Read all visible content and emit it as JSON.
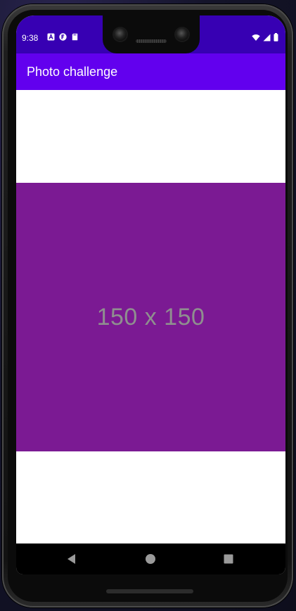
{
  "status_bar": {
    "time": "9:38",
    "left_icons": [
      "a-icon",
      "f-icon",
      "sd-card-icon"
    ],
    "right_icons": [
      "wifi-icon",
      "signal-icon",
      "battery-icon"
    ],
    "background": "#3700b3"
  },
  "app_bar": {
    "title": "Photo challenge",
    "background": "#6200ee"
  },
  "photo": {
    "placeholder_text": "150 x 150",
    "background": "#7b1a93",
    "text_color": "#8f8f8f"
  },
  "nav_bar": {
    "buttons": [
      "back-icon",
      "home-icon",
      "recents-icon"
    ]
  }
}
